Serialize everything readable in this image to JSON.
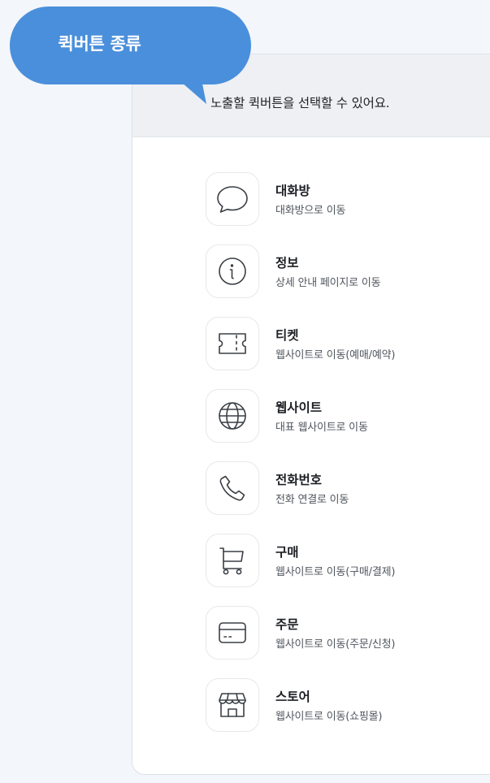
{
  "bubble": {
    "title": "퀵버튼 종류",
    "color": "#4a8fdb"
  },
  "header": {
    "text": "노출할  퀵버튼을 선택할 수 있어요."
  },
  "items": [
    {
      "icon": "chat-bubble-icon",
      "title": "대화방",
      "desc": "대화방으로 이동"
    },
    {
      "icon": "info-icon",
      "title": "정보",
      "desc": "상세 안내 페이지로 이동"
    },
    {
      "icon": "ticket-icon",
      "title": "티켓",
      "desc": "웹사이트로 이동(예매/예약)"
    },
    {
      "icon": "globe-icon",
      "title": "웹사이트",
      "desc": "대표 웹사이트로 이동"
    },
    {
      "icon": "phone-icon",
      "title": "전화번호",
      "desc": "전화 연결로 이동"
    },
    {
      "icon": "cart-icon",
      "title": "구매",
      "desc": "웹사이트로 이동(구매/결제)"
    },
    {
      "icon": "card-icon",
      "title": "주문",
      "desc": "웹사이트로 이동(주문/신청)"
    },
    {
      "icon": "store-icon",
      "title": "스토어",
      "desc": "웹사이트로 이동(쇼핑몰)"
    }
  ]
}
